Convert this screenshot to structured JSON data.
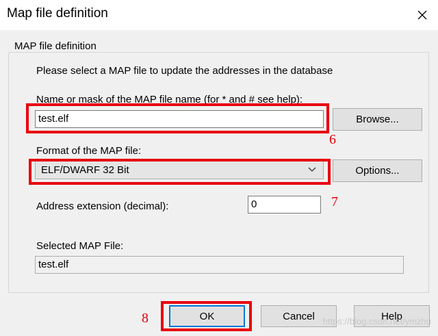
{
  "window": {
    "title": "Map file definition",
    "close_icon": "close-icon"
  },
  "group": {
    "legend": "MAP file definition",
    "instruction": "Please select a MAP file to update the addresses in the database",
    "name_label": "Name or mask of the MAP file name (for * and # see help):",
    "name_value": "test.elf",
    "browse_label": "Browse...",
    "format_label": "Format of the MAP file:",
    "format_value": "ELF/DWARF 32 Bit",
    "options_label": "Options...",
    "extension_label": "Address extension (decimal):",
    "extension_value": "0",
    "selected_label": "Selected MAP File:",
    "selected_value": "test.elf"
  },
  "buttons": {
    "ok": "OK",
    "cancel": "Cancel",
    "help": "Help"
  },
  "annotations": {
    "six": "6",
    "seven": "7",
    "eight": "8",
    "color": "#e8000b"
  },
  "watermark": "https://blog.csdn.net/ymzhu"
}
